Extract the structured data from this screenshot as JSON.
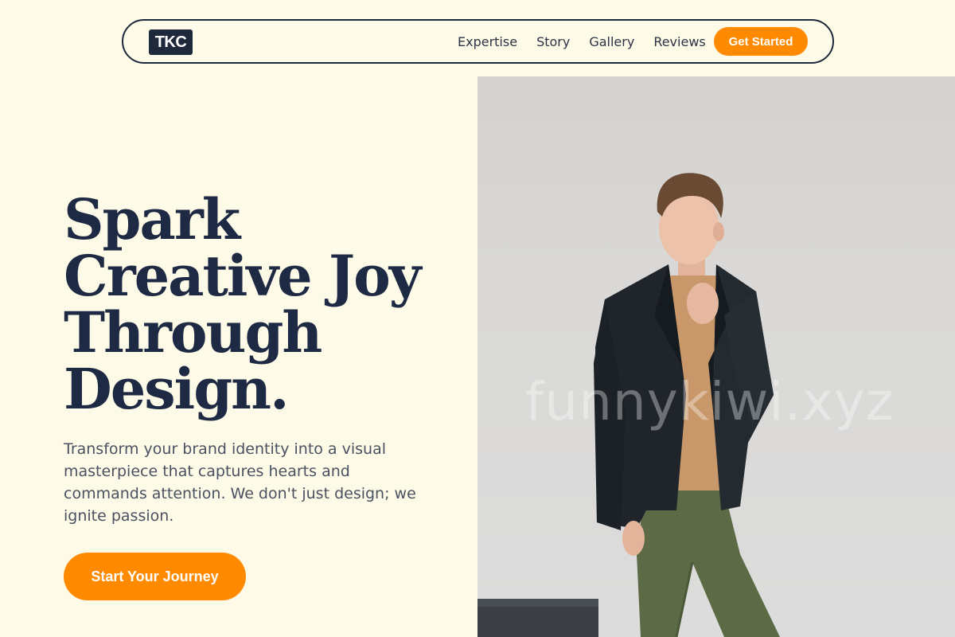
{
  "nav": {
    "logo": "TKC",
    "links": [
      "Expertise",
      "Story",
      "Gallery",
      "Reviews"
    ],
    "cta_label": "Get Started"
  },
  "hero": {
    "headline_lines": [
      "Spark",
      "Creative Joy",
      "Through",
      "Design."
    ],
    "subtext": "Transform your brand identity into a visual masterpiece that captures hearts and commands attention. We don't just design; we ignite passion.",
    "cta_label": "Start Your Journey",
    "image_watermark": "funnykiwi.xyz"
  },
  "colors": {
    "background": "#fefae8",
    "accent": "#ff8a00",
    "dark": "#1e293b"
  }
}
